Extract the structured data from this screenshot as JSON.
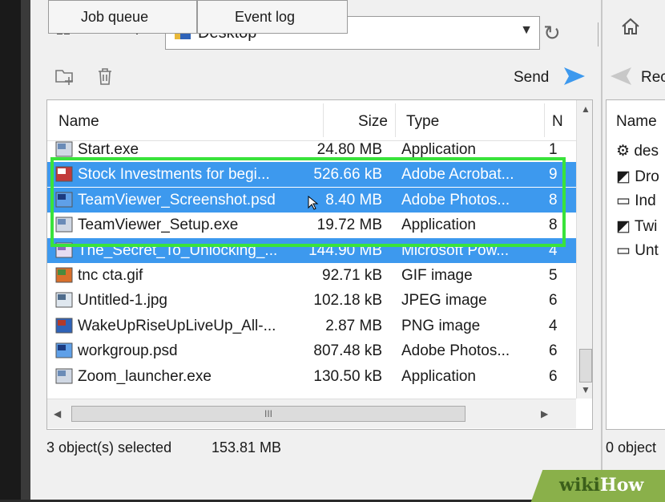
{
  "address_bar": {
    "path": "Desktop"
  },
  "toolbar": {
    "send_label": "Send"
  },
  "columns": {
    "name": "Name",
    "size": "Size",
    "type": "Type",
    "more": "N"
  },
  "files": [
    {
      "name": "Start.exe",
      "size": "24.80 MB",
      "type": "Application",
      "extra": "1",
      "icon": "exe-icon",
      "selected": false
    },
    {
      "name": "Stock Investments for begi...",
      "size": "526.66 kB",
      "type": "Adobe Acrobat...",
      "extra": "9",
      "icon": "pdf-icon",
      "selected": true
    },
    {
      "name": "TeamViewer_Screenshot.psd",
      "size": "8.40 MB",
      "type": "Adobe Photos...",
      "extra": "8",
      "icon": "psd-icon",
      "selected": true
    },
    {
      "name": "TeamViewer_Setup.exe",
      "size": "19.72 MB",
      "type": "Application",
      "extra": "8",
      "icon": "exe-icon",
      "selected": false
    },
    {
      "name": "The_Secret_To_Unlocking_...",
      "size": "144.90 MB",
      "type": "Microsoft Pow...",
      "extra": "4",
      "icon": "ppt-icon",
      "selected": true
    },
    {
      "name": "tnc cta.gif",
      "size": "92.71 kB",
      "type": "GIF image",
      "extra": "5",
      "icon": "gif-icon",
      "selected": false
    },
    {
      "name": "Untitled-1.jpg",
      "size": "102.18 kB",
      "type": "JPEG image",
      "extra": "6",
      "icon": "jpg-icon",
      "selected": false
    },
    {
      "name": "WakeUpRiseUpLiveUp_All-...",
      "size": "2.87 MB",
      "type": "PNG image",
      "extra": "4",
      "icon": "png-icon",
      "selected": false
    },
    {
      "name": "workgroup.psd",
      "size": "807.48 kB",
      "type": "Adobe Photos...",
      "extra": "6",
      "icon": "psd-icon",
      "selected": false
    },
    {
      "name": "Zoom_launcher.exe",
      "size": "130.50 kB",
      "type": "Application",
      "extra": "6",
      "icon": "exe-icon",
      "selected": false
    }
  ],
  "status": {
    "selected_count": "3 object(s) selected",
    "selected_size": "153.81 MB"
  },
  "tabs": [
    "Job queue",
    "Event log"
  ],
  "hscroll_grip": "III",
  "right_pane": {
    "toolbar_label": "Rec",
    "header": "Name",
    "items": [
      "des",
      "Dro",
      "Ind",
      "Twi",
      "Unt"
    ],
    "status": "0 object"
  },
  "watermark": "wikiHow"
}
